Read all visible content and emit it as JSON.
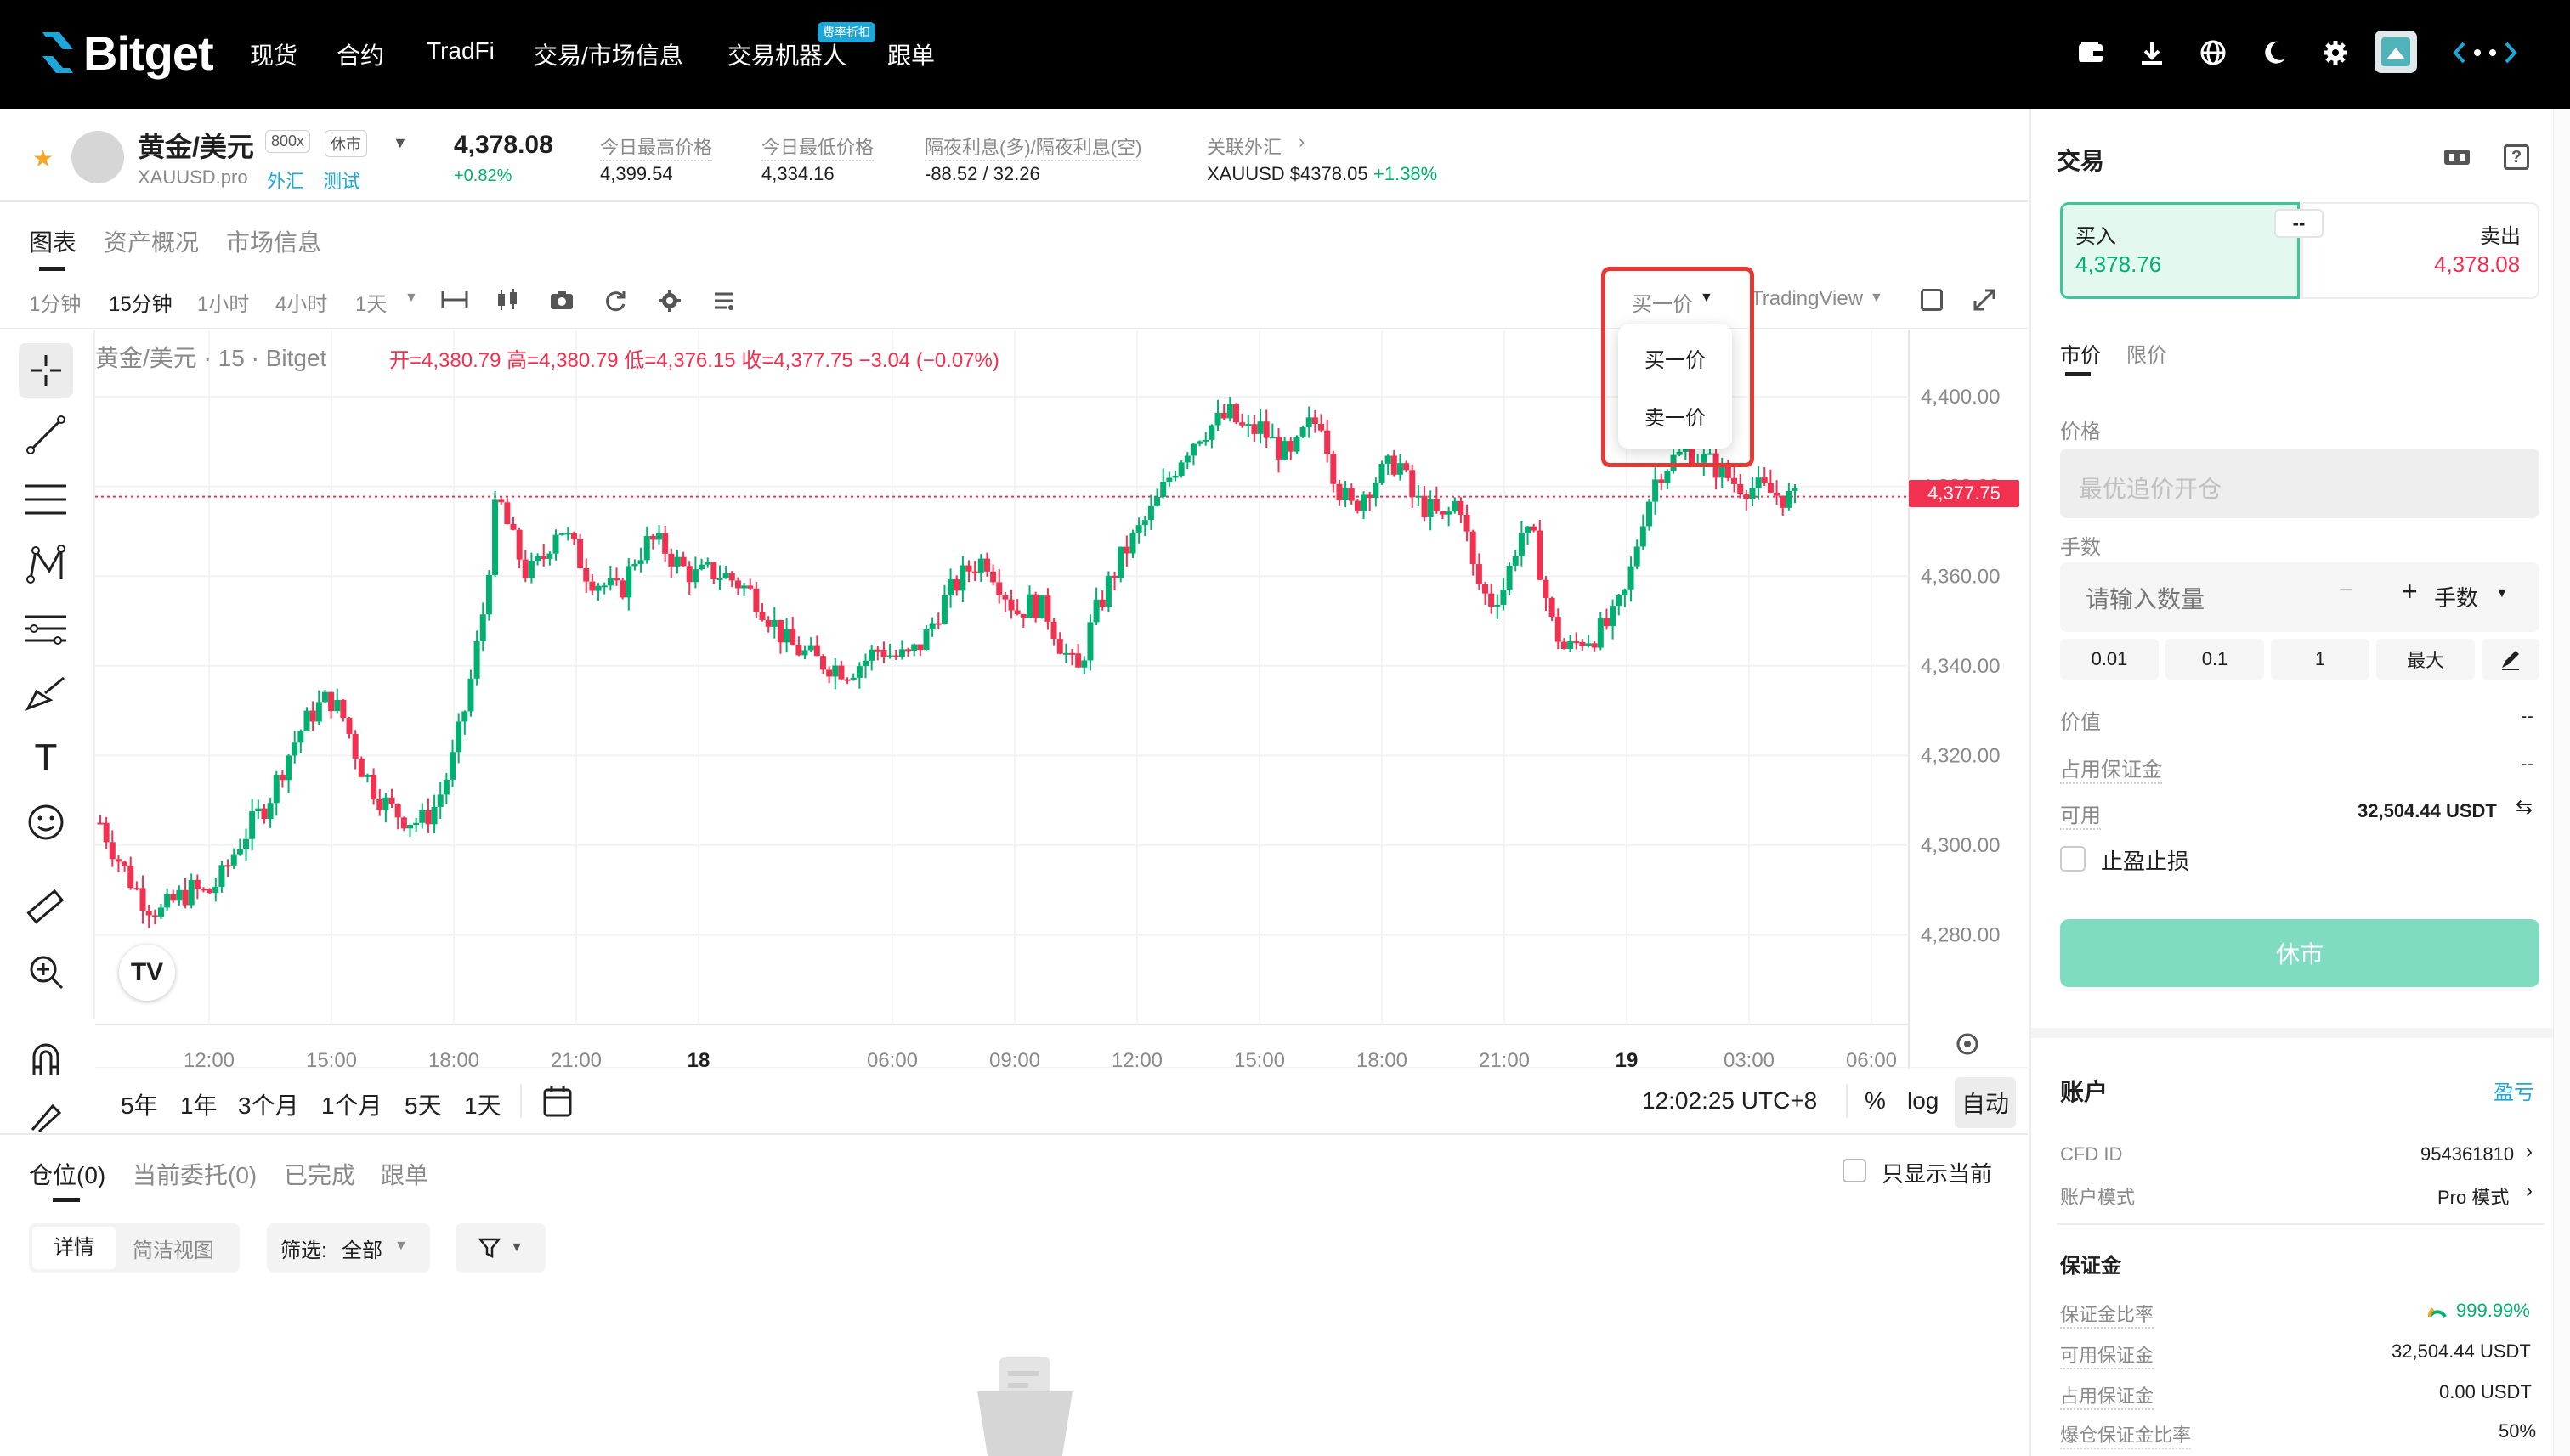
{
  "nav": {
    "logo": "Bitget",
    "items": [
      "现货",
      "合约",
      "TradFi",
      "交易/市场信息",
      "交易机器人",
      "跟单"
    ],
    "bot_badge": "费率折扣",
    "icons": [
      "wallet-icon",
      "download-icon",
      "globe-icon",
      "moon-icon",
      "gear-icon",
      "avatar",
      "connect-icon"
    ]
  },
  "symbol": {
    "name": "黄金/美元",
    "leverage": "800x",
    "status": "休市",
    "source": "XAUUSD.pro",
    "tag1": "外汇",
    "tag2": "测试",
    "price": "4,378.08",
    "change": "+0.82%",
    "stats": [
      {
        "label": "今日最高价格",
        "value": "4,399.54"
      },
      {
        "label": "今日最低价格",
        "value": "4,334.16"
      },
      {
        "label": "隔夜利息(多)/隔夜利息(空)",
        "value": "-88.52 / 32.26"
      }
    ],
    "related_label": "关联外汇",
    "related_value": "XAUUSD $4378.05",
    "related_change": "+1.38%"
  },
  "tabs": [
    "图表",
    "资产概况",
    "市场信息"
  ],
  "intervals": [
    "1分钟",
    "15分钟",
    "1小时",
    "4小时",
    "1天"
  ],
  "price_type": "买一价",
  "price_type_menu": [
    "买一价",
    "卖一价"
  ],
  "chart_provider": "TradingView",
  "chart_legend": {
    "title": "黄金/美元 · 15 · Bitget",
    "ohlc": "开=4,380.79  高=4,380.79  低=4,376.15  收=4,377.75  −3.04 (−0.07%)"
  },
  "current_price_tag": "4,377.75",
  "ranges": [
    "5年",
    "1年",
    "3个月",
    "1个月",
    "5天",
    "1天"
  ],
  "clock": "12:02:25 UTC+8",
  "scale_opts": [
    "%",
    "log",
    "自动"
  ],
  "chart_data": {
    "type": "candlestick",
    "title": "黄金/美元 · 15 · Bitget",
    "y_ticks": [
      4400,
      4380,
      4360,
      4340,
      4320,
      4300,
      4280
    ],
    "y_tick_labels": [
      "4,400.00",
      "4,380.00",
      "4,360.00",
      "4,340.00",
      "4,320.00",
      "4,300.00",
      "4,280.00"
    ],
    "x_tick_labels": [
      "12:00",
      "15:00",
      "18:00",
      "21:00",
      "18",
      "06:00",
      "09:00",
      "12:00",
      "15:00",
      "18:00",
      "21:00",
      "19",
      "03:00",
      "06:00"
    ],
    "ylim": [
      4260,
      4415
    ],
    "close_path": [
      4305,
      4298,
      4292,
      4287,
      4285,
      4288,
      4290,
      4289,
      4293,
      4300,
      4305,
      4310,
      4318,
      4325,
      4330,
      4333,
      4328,
      4318,
      4312,
      4308,
      4306,
      4305,
      4309,
      4318,
      4332,
      4350,
      4378,
      4368,
      4360,
      4364,
      4372,
      4366,
      4360,
      4358,
      4356,
      4364,
      4368,
      4366,
      4362,
      4360,
      4361,
      4360,
      4358,
      4355,
      4350,
      4345,
      4343,
      4341,
      4340,
      4339,
      4341,
      4344,
      4342,
      4342,
      4346,
      4353,
      4358,
      4362,
      4364,
      4358,
      4352,
      4354,
      4352,
      4344,
      4338,
      4350,
      4358,
      4365,
      4370,
      4375,
      4382,
      4388,
      4392,
      4394,
      4396,
      4392,
      4393,
      4389,
      4386,
      4393,
      4395,
      4380,
      4375,
      4380,
      4383,
      4386,
      4377,
      4375,
      4372,
      4378,
      4360,
      4354,
      4358,
      4370,
      4367,
      4350,
      4343,
      4346,
      4347,
      4350,
      4357,
      4373,
      4383,
      4386,
      4388,
      4386,
      4384,
      4381,
      4380,
      4379,
      4378,
      4377
    ]
  },
  "bottom": {
    "tabs": [
      "仓位(0)",
      "当前委托(0)",
      "已完成",
      "跟单"
    ],
    "only_current": "只显示当前",
    "views": [
      "详情",
      "简洁视图"
    ],
    "filter_label": "筛选:",
    "filter_value": "全部"
  },
  "trade": {
    "title": "交易",
    "buy_label": "买入",
    "buy_price": "4,378.76",
    "spread": "--",
    "sell_label": "卖出",
    "sell_price": "4,378.08",
    "order_tabs": [
      "市价",
      "限价"
    ],
    "price_label": "价格",
    "price_placeholder": "最优追价开仓",
    "qty_label": "手数",
    "qty_placeholder": "请输入数量",
    "qty_minus": "−",
    "qty_plus": "+",
    "qty_unit": "手数",
    "quick": [
      "0.01",
      "0.1",
      "1",
      "最大"
    ],
    "value_label": "价值",
    "value": "--",
    "margin_label": "占用保证金",
    "margin": "--",
    "avail_label": "可用",
    "avail": "32,504.44 USDT",
    "tpsl": "止盈止损",
    "submit": "休市"
  },
  "account": {
    "title": "账户",
    "pnl_link": "盈亏",
    "cfd_label": "CFD ID",
    "cfd": "954361810",
    "mode_label": "账户模式",
    "mode": "Pro 模式",
    "margin_title": "保证金",
    "ratio_label": "保证金比率",
    "ratio": "999.99%",
    "avail_margin_label": "可用保证金",
    "avail_margin": "32,504.44 USDT",
    "used_margin_label": "占用保证金",
    "used_margin": "0.00 USDT",
    "liq_label": "爆仓保证金比率",
    "liq": "50%"
  },
  "colors": {
    "up": "#00b070",
    "down": "#f2304f",
    "accent": "#1ea6d9",
    "submit": "#7fdcc0"
  }
}
